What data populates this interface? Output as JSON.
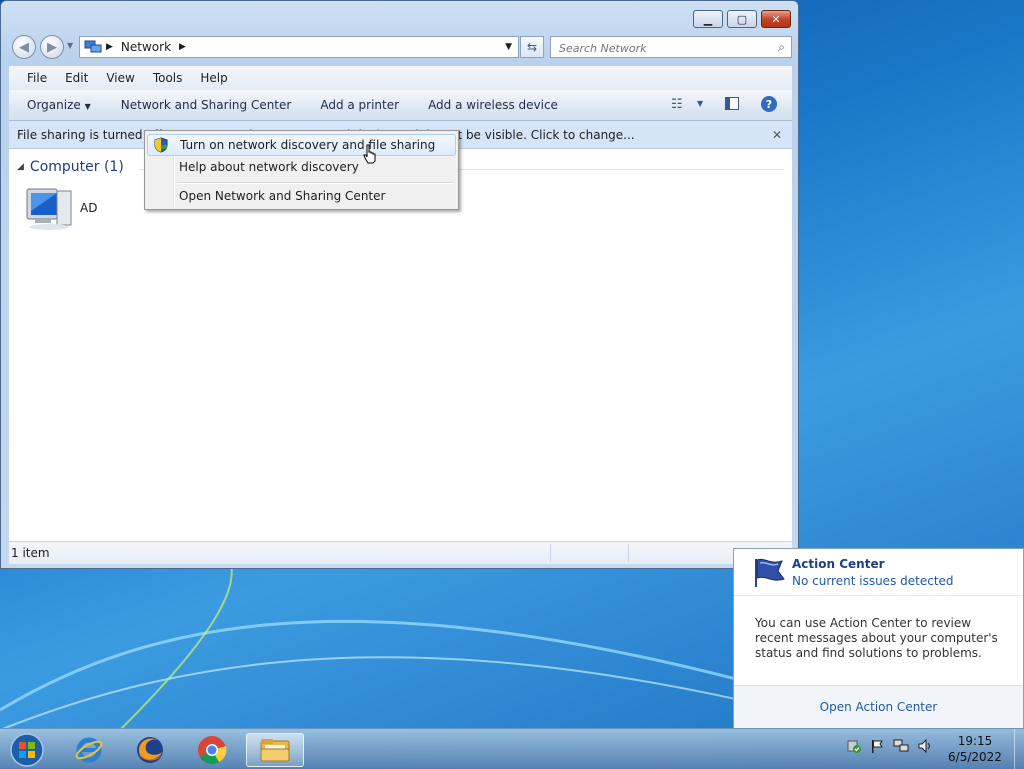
{
  "window": {
    "address_segment": "Network",
    "search_placeholder": "Search Network",
    "menu": [
      "File",
      "Edit",
      "View",
      "Tools",
      "Help"
    ],
    "commands": [
      "Organize",
      "Network and Sharing Center",
      "Add a printer",
      "Add a wireless device"
    ],
    "infobar_text": "File sharing is turned off. Some network computers and devices might not be visible. Click to change...",
    "group_label": "Computer (1)",
    "items": [
      {
        "label": "AD",
        "icon": "computer-icon"
      }
    ],
    "status_text": "1 item"
  },
  "context_menu": {
    "items": [
      {
        "label": "Turn on network discovery and file sharing",
        "icon": "uac-shield-icon",
        "highlighted": true
      },
      {
        "label": "Help about network discovery"
      },
      {
        "label": "Open Network and Sharing Center"
      }
    ]
  },
  "action_center": {
    "title": "Action Center",
    "subtitle": "No current issues detected",
    "body": "You can use Action Center to review recent messages about your computer's status and find solutions to problems.",
    "link": "Open Action Center"
  },
  "taskbar": {
    "apps": [
      "start-orb",
      "internet-explorer",
      "firefox",
      "chrome",
      "windows-explorer"
    ],
    "clock_time": "19:15",
    "clock_date": "6/5/2022"
  }
}
